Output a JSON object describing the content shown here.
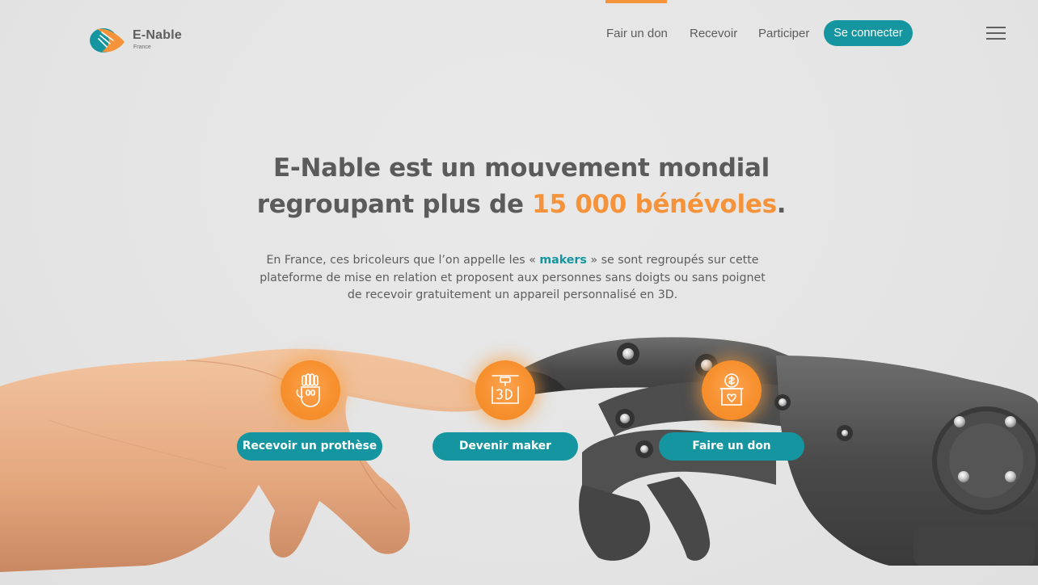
{
  "brand": {
    "name": "E-Nable",
    "sub": "France",
    "colors": {
      "accent": "#f5933a",
      "primary": "#15959f",
      "text": "#5b5b5b"
    }
  },
  "nav": {
    "items": [
      {
        "label": "Fair un don",
        "active": true
      },
      {
        "label": "Recevoir",
        "active": false
      },
      {
        "label": "Participer",
        "active": false
      }
    ],
    "login_label": "Se connecter",
    "menu_icon": "hamburger-icon"
  },
  "hero": {
    "headline_line1": "E-Nable est un mouvement mondial",
    "headline_line2_prefix": "regroupant plus de ",
    "headline_highlight": "15 000 bénévoles",
    "headline_suffix": ".",
    "intro_before": "En France, ces bricoleurs que l’on appelle les « ",
    "intro_link": "makers",
    "intro_after_line1": " » se sont regroupés sur cette",
    "intro_line2": "plateforme de mise  en relation et proposent aux personnes sans doigts ou sans  poignet",
    "intro_line3": "de recevoir gratuitement un appareil personnalisé en 3D."
  },
  "ctas": [
    {
      "label": "Recevoir un prothèse",
      "icon": "prosthetic-hand-icon"
    },
    {
      "label": "Devenir maker",
      "icon": "3d-printer-icon"
    },
    {
      "label": "Faire un don",
      "icon": "donation-box-icon"
    }
  ]
}
